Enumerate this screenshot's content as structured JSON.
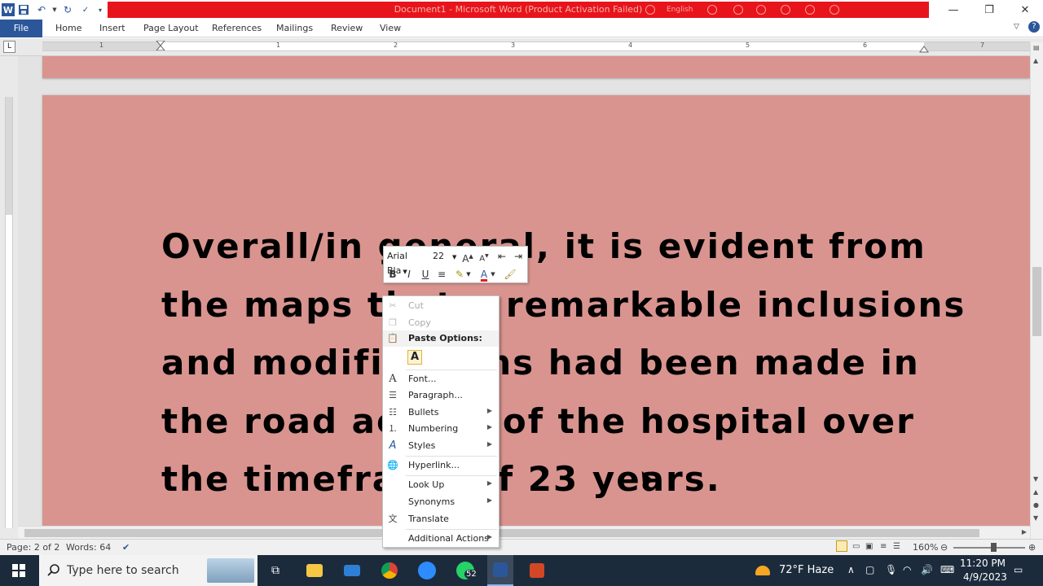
{
  "titlebar": {
    "title": "Document1 - Microsoft Word (Product Activation Failed)",
    "language": "English"
  },
  "ribbon": {
    "tabs": [
      {
        "label": "File"
      },
      {
        "label": "Home"
      },
      {
        "label": "Insert"
      },
      {
        "label": "Page Layout"
      },
      {
        "label": "References"
      },
      {
        "label": "Mailings"
      },
      {
        "label": "Review"
      },
      {
        "label": "View"
      }
    ]
  },
  "ruler": {
    "numbers": [
      "1",
      "1",
      "2",
      "3",
      "4",
      "5",
      "6",
      "7"
    ]
  },
  "document": {
    "page_color": "#d9948f",
    "lines": [
      "Overall/in general, it is evident from",
      "the maps that a remarkable inclusions",
      "and modifications had been made in",
      "the road access of the hospital over",
      "the timeframe of 23 years."
    ]
  },
  "mini_toolbar": {
    "font": "Arial Bla",
    "size": "22"
  },
  "context_menu": {
    "cut": "Cut",
    "copy": "Copy",
    "paste_options": "Paste Options:",
    "paste_keep_text": "A",
    "font": "Font...",
    "paragraph": "Paragraph...",
    "bullets": "Bullets",
    "numbering": "Numbering",
    "styles": "Styles",
    "hyperlink": "Hyperlink...",
    "look_up": "Look Up",
    "synonyms": "Synonyms",
    "translate": "Translate",
    "additional_actions": "Additional Actions"
  },
  "statusbar": {
    "page": "Page: 2 of 2",
    "words": "Words: 64",
    "zoom": "160%"
  },
  "taskbar": {
    "search_placeholder": "Type here to search",
    "whatsapp_badge": "52",
    "weather": "72°F  Haze",
    "time": "11:20 PM",
    "date": "4/9/2023"
  },
  "colors": {
    "accent": "#2b579a",
    "activation_bar": "#e8141c",
    "taskbar": "#1c2b3c"
  }
}
